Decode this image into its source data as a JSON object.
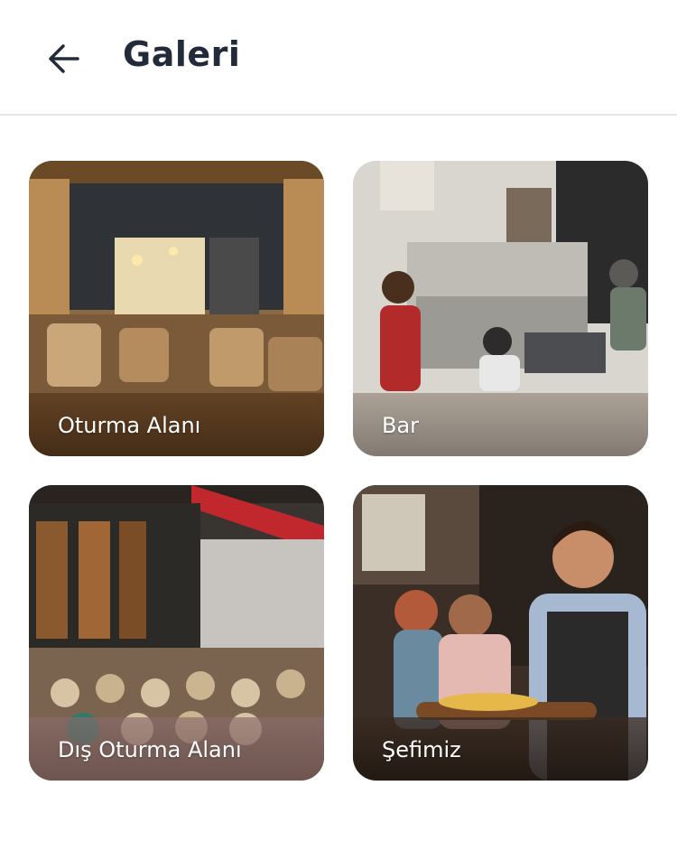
{
  "header": {
    "back_icon": "arrow-left-icon",
    "title": "Galeri"
  },
  "gallery": {
    "items": [
      {
        "label": "Oturma Alanı"
      },
      {
        "label": "Bar"
      },
      {
        "label": "Dış Oturma Alanı"
      },
      {
        "label": "Şefimiz"
      }
    ]
  },
  "colors": {
    "title": "#222b3a",
    "divider": "#e6e6e6",
    "caption_text": "#ffffff"
  }
}
